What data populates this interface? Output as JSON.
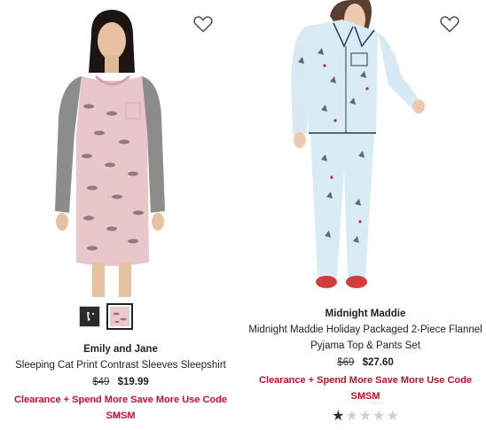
{
  "products": [
    {
      "brand": "Emily and Jane",
      "title": "Sleeping Cat Print Contrast Sleeves Sleepshirt",
      "original_price": "$49",
      "sale_price": "$19.99",
      "promo": "Clearance + Spend More Save More Use Code SMSM",
      "image_alt": "Woman wearing pink sleepshirt with grey raglan sleeves and sleeping cat print",
      "swatches": [
        {
          "color": "#2a2a2a",
          "selected": false
        },
        {
          "color": "#e9c9cd",
          "selected": true
        }
      ]
    },
    {
      "brand": "Midnight Maddie",
      "title": "Midnight Maddie Holiday Packaged 2-Piece Flannel Pyjama Top & Pants Set",
      "original_price": "$69",
      "sale_price": "$27.60",
      "promo": "Clearance + Spend More Save More Use Code SMSM",
      "image_alt": "Woman wearing light blue flannel pyjama set with skier print",
      "rating": 1,
      "rating_max": 5
    }
  ],
  "colors": {
    "promo_red": "#c8102e",
    "text": "#222222"
  },
  "icons": {
    "wishlist": "heart-outline-icon",
    "star": "star-icon"
  }
}
